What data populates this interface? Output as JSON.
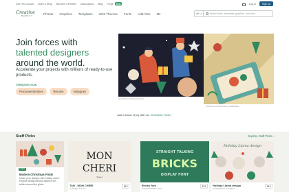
{
  "topbar": {
    "links": [
      "Get Free Goods",
      "Open a Shop",
      "Become a Partner",
      "Discussions",
      "Blog",
      "Forge"
    ],
    "forge_badge": "Beta",
    "login": "Log in",
    "signup": "Sign up"
  },
  "nav": {
    "logo_main": "Creative",
    "logo_sub": "MARKET",
    "items": [
      "Photos",
      "Graphics",
      "Templates",
      "Web Themes",
      "Fonts",
      "Add-Ons",
      "3D"
    ],
    "search_scope": "All",
    "search_placeholder": "Search fonts, templates, graphics, and more"
  },
  "hero": {
    "title_line1": "Join forces with",
    "title_accent": "talented designers",
    "title_line3": "around the world.",
    "subtitle": "Accelerate your projects with millions of ready-to-use products.",
    "trending_label": "TRENDING NOW",
    "pills": [
      "Procreate Brushes",
      "Textures",
      "Instagram"
    ],
    "caption1": "Hand Drawn Christmas by Anna",
    "caption2": "Christmas with Santa Set by PixelBuddha",
    "add_touch": "Add a touch of joy with our",
    "add_touch_link": "Christmas Finds ›"
  },
  "staff": {
    "title": "Staff Picks",
    "explore": "Explore Staff Picks ›",
    "feature": {
      "tag": "FINDS",
      "title": "Modern Christmas Finds",
      "description": "Infuse your designs with holiday cheer! Explore design-forward assets from artists around the globe."
    },
    "cards": [
      {
        "title": "TAN - MON CHERI",
        "by": "by TanType in Fonts",
        "price": "$15",
        "art_line1": "MON",
        "art_line2": "CHERI",
        "art_line3": "TAN"
      },
      {
        "title": "Bricks font",
        "by": "by TypeKimPOD in Fonts",
        "price": "$15",
        "art_top": "STRAIGHT TALKING",
        "art_main": "BRICKS",
        "art_bottom": "DISPLAY FONT"
      },
      {
        "title": "Holiday Llama design",
        "by": "by designstoreJ in Graphics",
        "price": "$16",
        "art_text": "Holiday Llama design"
      }
    ]
  },
  "colors": {
    "brand_green": "#2d5b3e",
    "accent_green": "#3a8f64",
    "pill_bg": "#f8dcc3",
    "signup_blue": "#1f5a86"
  }
}
